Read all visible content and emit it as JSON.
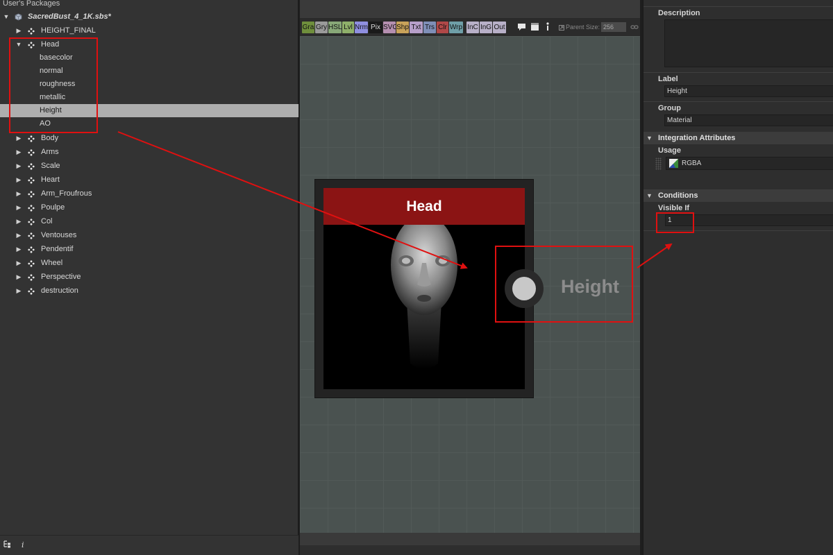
{
  "explorer": {
    "header": "User's Packages",
    "package_name": "SacredBust_4_1K.sbs*",
    "graphs": [
      {
        "label": "HEIGHT_FINAL",
        "expanded": false
      },
      {
        "label": "Head",
        "expanded": true
      },
      {
        "label": "Body",
        "expanded": false
      },
      {
        "label": "Arms",
        "expanded": false
      },
      {
        "label": "Scale",
        "expanded": false
      },
      {
        "label": "Heart",
        "expanded": false
      },
      {
        "label": "Arm_Froufrous",
        "expanded": false
      },
      {
        "label": "Poulpe",
        "expanded": false
      },
      {
        "label": "Col",
        "expanded": false
      },
      {
        "label": "Ventouses",
        "expanded": false
      },
      {
        "label": "Pendentif",
        "expanded": false
      },
      {
        "label": "Wheel",
        "expanded": false
      },
      {
        "label": "Perspective",
        "expanded": false
      },
      {
        "label": "destruction",
        "expanded": false
      }
    ],
    "head_outputs": [
      "basecolor",
      "normal",
      "roughness",
      "metallic",
      "Height",
      "AO"
    ],
    "selected_output": "Height",
    "footer": {
      "info_icon": "i"
    }
  },
  "toolbar": {
    "buttons": [
      {
        "label": "Gra",
        "color": "#6f8f3c"
      },
      {
        "label": "Gry",
        "color": "#9a9a9a"
      },
      {
        "label": "HSL",
        "color": "#88a878"
      },
      {
        "label": "Lvl",
        "color": "#8fb06a"
      },
      {
        "label": "Nrm",
        "color": "#8f8fe0"
      },
      {
        "label": "Pix",
        "color": "#1a1a1a"
      },
      {
        "label": "SVG",
        "color": "#b58fb0"
      },
      {
        "label": "Shp",
        "color": "#c9a35a"
      },
      {
        "label": "Txt",
        "color": "#b79fc9"
      },
      {
        "label": "Trs",
        "color": "#7f8fb8"
      },
      {
        "label": "Clr",
        "color": "#b04848"
      },
      {
        "label": "Wrp",
        "color": "#6f9fa8"
      },
      {
        "label": "InC",
        "color": "#b8b0c8"
      },
      {
        "label": "InG",
        "color": "#b8b0c8"
      },
      {
        "label": "Out",
        "color": "#b8b0c8"
      }
    ],
    "parent_size_label": "Parent Size:",
    "parent_size_value": "256"
  },
  "node": {
    "title": "Head",
    "output_label": "Height",
    "title_color": "#8b1414"
  },
  "properties": {
    "description_label": "Description",
    "description_value": "",
    "label_label": "Label",
    "label_value": "Height",
    "group_label": "Group",
    "group_value": "Material",
    "integration_section": "Integration Attributes",
    "usage_label": "Usage",
    "usage_value": "RGBA",
    "conditions_section": "Conditions",
    "visible_if_label": "Visible If",
    "visible_if_value": "1"
  },
  "colors": {
    "highlight": "#e01010",
    "selection": "#aeaeae"
  }
}
